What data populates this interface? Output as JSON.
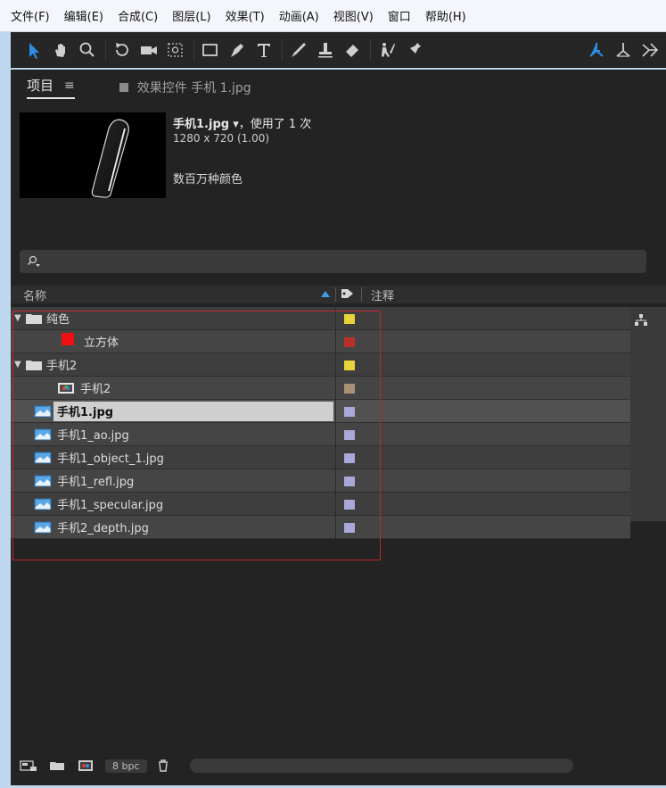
{
  "menu": [
    "文件(F)",
    "编辑(E)",
    "合成(C)",
    "图层(L)",
    "效果(T)",
    "动画(A)",
    "视图(V)",
    "窗口",
    "帮助(H)"
  ],
  "toolbar": {
    "tools": [
      "selection-tool",
      "hand-tool",
      "zoom-tool",
      "rotation-tool",
      "camera-tool",
      "pan-behind-tool",
      "rectangle-tool",
      "pen-tool",
      "type-tool",
      "brush-tool",
      "clone-stamp-tool",
      "eraser-tool",
      "roto-brush-tool",
      "puppet-pin-tool"
    ],
    "right_tools": [
      "local-axis-mode",
      "world-axis-mode",
      "view-axis-mode"
    ],
    "accent": "#2b8de6"
  },
  "panel": {
    "tab_active": "项目",
    "tab_inactive": "效果控件 手机 1.jpg"
  },
  "preview_info": {
    "filename_bold": "手机1.jpg",
    "filename_rest": " ▾，使用了 1 次",
    "dimensions": "1280 x 720 (1.00)",
    "colors": "数百万种颜色"
  },
  "search": {
    "placeholder": "",
    "value": ""
  },
  "columns": {
    "name": "名称",
    "comment": "注释"
  },
  "items": [
    {
      "name": "纯色",
      "type": "folder",
      "label_color": "#e6d43a",
      "expanded": true
    },
    {
      "name": "立方体",
      "type": "solid",
      "label_color": "#b8302c",
      "indent": 1,
      "swatch": "#ee1010"
    },
    {
      "name": "手机2",
      "type": "folder",
      "label_color": "#e6d43a",
      "expanded": true
    },
    {
      "name": "手机2",
      "type": "composition",
      "label_color": "#a89074",
      "indent": 1
    },
    {
      "name": "手机1.jpg",
      "type": "footage",
      "label_color": "#a9a8d8",
      "selected": true
    },
    {
      "name": "手机1_ao.jpg",
      "type": "footage",
      "label_color": "#a9a8d8"
    },
    {
      "name": "手机1_object_1.jpg",
      "type": "footage",
      "label_color": "#a9a8d8"
    },
    {
      "name": "手机1_refl.jpg",
      "type": "footage",
      "label_color": "#a9a8d8"
    },
    {
      "name": "手机1_specular.jpg",
      "type": "footage",
      "label_color": "#a9a8d8"
    },
    {
      "name": "手机2_depth.jpg",
      "type": "footage",
      "label_color": "#a9a8d8"
    }
  ],
  "footer": {
    "bpc": "8 bpc"
  },
  "highlight_color": "#c0262c"
}
